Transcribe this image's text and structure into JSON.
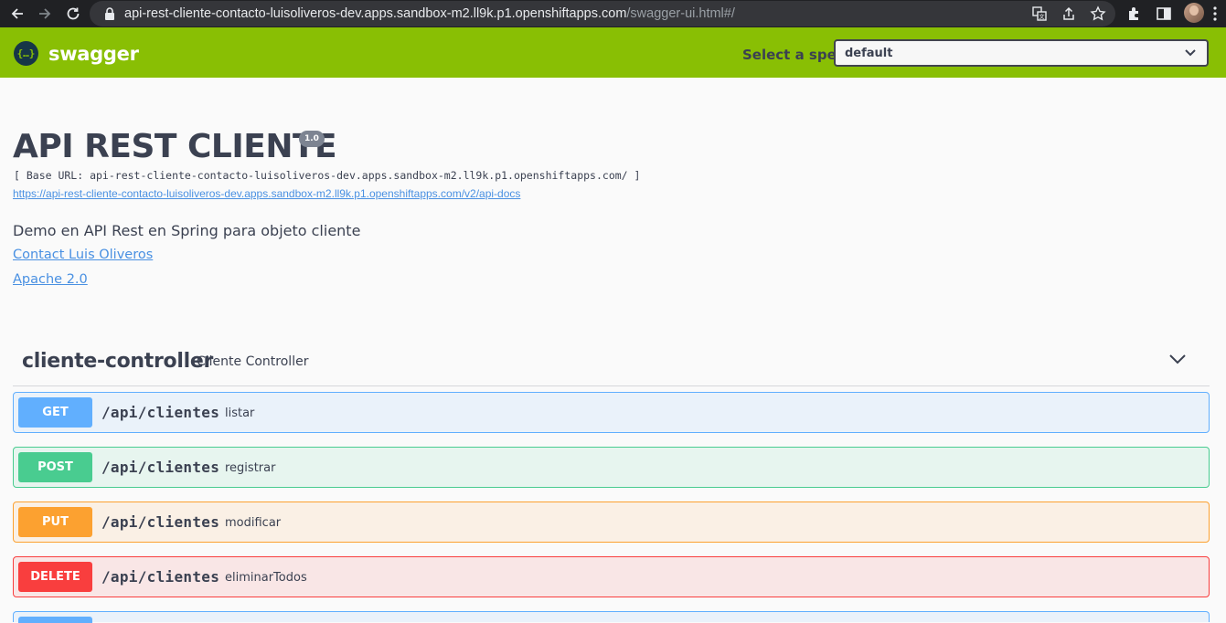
{
  "browser": {
    "url_host": "api-rest-cliente-contacto-luisoliveros-dev.apps.sandbox-m2.ll9k.p1.openshiftapps.com",
    "url_path": "/swagger-ui.html#/"
  },
  "topbar": {
    "logo_mark": "{…}",
    "logo_text": "swagger",
    "spec_label": "Select a spec",
    "spec_value": "default"
  },
  "info": {
    "title": "API REST CLIENTE",
    "version": "1.0",
    "base_url": "[ Base URL: api-rest-cliente-contacto-luisoliveros-dev.apps.sandbox-m2.ll9k.p1.openshiftapps.com/ ]",
    "api_docs_link": "https://api-rest-cliente-contacto-luisoliveros-dev.apps.sandbox-m2.ll9k.p1.openshiftapps.com/v2/api-docs",
    "description": "Demo en API Rest en Spring para objeto cliente",
    "contact": "Contact Luis Oliveros",
    "license": "Apache 2.0"
  },
  "tag": {
    "name": "cliente-controller",
    "description": "Cliente Controller"
  },
  "operations": [
    {
      "method": "GET",
      "path": "/api/clientes",
      "summary": "listar"
    },
    {
      "method": "POST",
      "path": "/api/clientes",
      "summary": "registrar"
    },
    {
      "method": "PUT",
      "path": "/api/clientes",
      "summary": "modificar"
    },
    {
      "method": "DELETE",
      "path": "/api/clientes",
      "summary": "eliminarTodos"
    }
  ],
  "colors": {
    "topbar": "#89bf04",
    "get": "#61affe",
    "post": "#49cc90",
    "put": "#fca130",
    "delete": "#f93e3e"
  }
}
